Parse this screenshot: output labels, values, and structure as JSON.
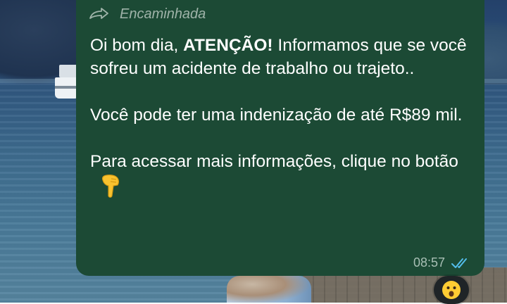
{
  "message": {
    "forwarded_label": "Encaminhada",
    "line1_prefix": "Oi bom dia, ",
    "line1_bold": "ATENÇÃO!",
    "line1_suffix": " Informamos que se você sofreu um acidente de trabalho ou trajeto..",
    "paragraph2": "Você pode ter uma indenização de até R$89 mil.",
    "paragraph3": "Para acessar mais informações, clique no botão",
    "time": "08:57",
    "status": "delivered-double-check-icon"
  },
  "icons": {
    "forward": "forward-arrow-icon",
    "pointing_down": "backhand-index-pointing-down-emoji",
    "reaction": "astonished-face-emoji"
  },
  "colors": {
    "bubble": "#1c4a35",
    "meta_text": "#a9bfb5",
    "forwarded_text": "#9fb3a9",
    "ticks": "#53bdeb"
  }
}
